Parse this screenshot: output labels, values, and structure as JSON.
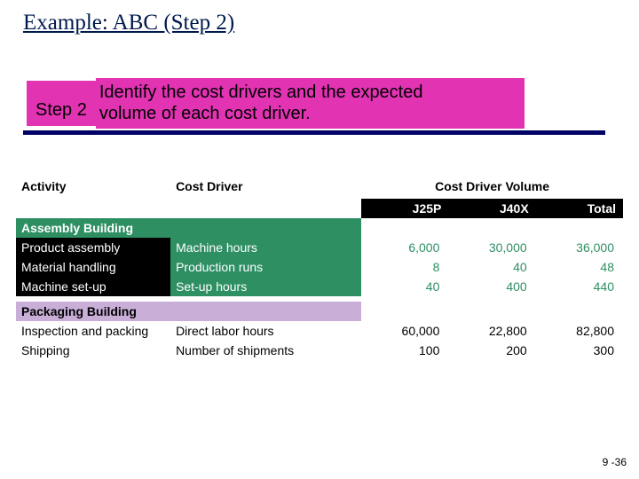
{
  "title": "Example: ABC (Step 2)",
  "step": {
    "label": "Step 2",
    "desc_line1": "Identify the cost drivers and the expected",
    "desc_line2": "volume of each cost driver."
  },
  "headers": {
    "activity": "Activity",
    "driver": "Cost Driver",
    "volume": "Cost Driver Volume",
    "j25p": "J25P",
    "j40x": "J40X",
    "total": "Total"
  },
  "buildings": {
    "assembly": "Assembly  Building",
    "packaging": "Packaging  Building"
  },
  "rows": {
    "assembly": [
      {
        "act": "Product assembly",
        "drv": "Machine hours",
        "a": "6,000",
        "b": "30,000",
        "t": "36,000"
      },
      {
        "act": "Material handling",
        "drv": "Production runs",
        "a": "8",
        "b": "40",
        "t": "48"
      },
      {
        "act": "Machine set-up",
        "drv": "Set-up hours",
        "a": "40",
        "b": "400",
        "t": "440"
      }
    ],
    "packaging": [
      {
        "act": "Inspection and packing",
        "drv": "Direct labor hours",
        "a": "60,000",
        "b": "22,800",
        "t": "82,800"
      },
      {
        "act": "Shipping",
        "drv": "Number of shipments",
        "a": "100",
        "b": "200",
        "t": "300"
      }
    ]
  },
  "pager": "9 -36",
  "chart_data": {
    "type": "table",
    "title": "Cost drivers and expected volume (Step 2)",
    "columns": [
      "Activity",
      "Cost Driver",
      "J25P",
      "J40X",
      "Total"
    ],
    "sections": [
      {
        "name": "Assembly Building",
        "rows": [
          [
            "Product assembly",
            "Machine hours",
            6000,
            30000,
            36000
          ],
          [
            "Material handling",
            "Production runs",
            8,
            40,
            48
          ],
          [
            "Machine set-up",
            "Set-up hours",
            40,
            400,
            440
          ]
        ]
      },
      {
        "name": "Packaging Building",
        "rows": [
          [
            "Inspection and packing",
            "Direct labor hours",
            60000,
            22800,
            82800
          ],
          [
            "Shipping",
            "Number of shipments",
            100,
            200,
            300
          ]
        ]
      }
    ]
  }
}
